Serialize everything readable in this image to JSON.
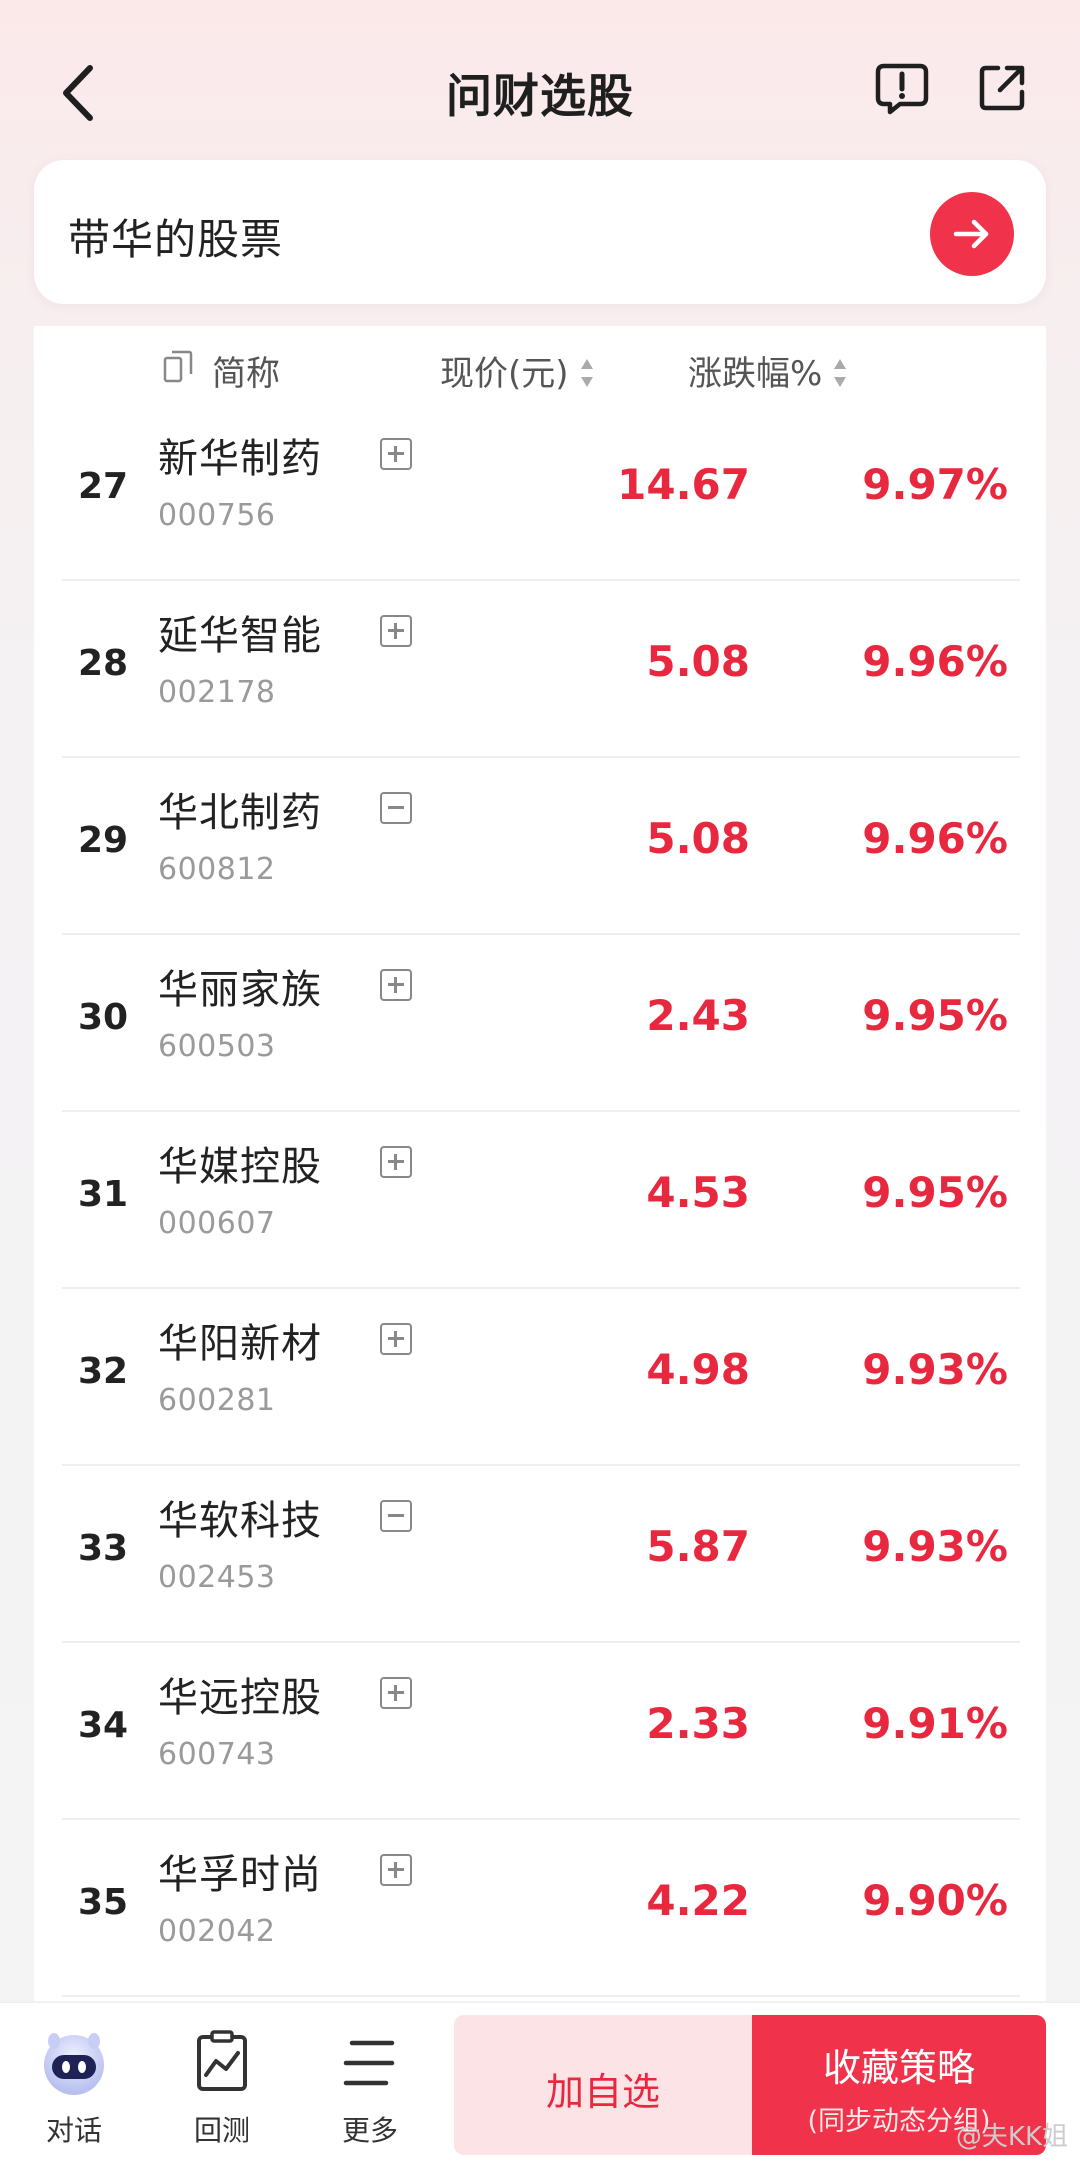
{
  "header": {
    "title": "问财选股",
    "back_icon": "chevron-left-icon",
    "feedback_icon": "feedback-icon",
    "share_icon": "share-icon"
  },
  "query": {
    "text": "带华的股票",
    "submit_icon": "arrow-right-icon"
  },
  "table": {
    "columns": {
      "name": "简称",
      "price": "现价(元)",
      "change": "涨跌幅%"
    },
    "rows": [
      {
        "index": "27",
        "name": "新华制药",
        "code": "000756",
        "price": "14.67",
        "change": "9.97%",
        "toggle": "plus"
      },
      {
        "index": "28",
        "name": "延华智能",
        "code": "002178",
        "price": "5.08",
        "change": "9.96%",
        "toggle": "plus"
      },
      {
        "index": "29",
        "name": "华北制药",
        "code": "600812",
        "price": "5.08",
        "change": "9.96%",
        "toggle": "minus"
      },
      {
        "index": "30",
        "name": "华丽家族",
        "code": "600503",
        "price": "2.43",
        "change": "9.95%",
        "toggle": "plus"
      },
      {
        "index": "31",
        "name": "华媒控股",
        "code": "000607",
        "price": "4.53",
        "change": "9.95%",
        "toggle": "plus"
      },
      {
        "index": "32",
        "name": "华阳新材",
        "code": "600281",
        "price": "4.98",
        "change": "9.93%",
        "toggle": "plus"
      },
      {
        "index": "33",
        "name": "华软科技",
        "code": "002453",
        "price": "5.87",
        "change": "9.93%",
        "toggle": "minus"
      },
      {
        "index": "34",
        "name": "华远控股",
        "code": "600743",
        "price": "2.33",
        "change": "9.91%",
        "toggle": "plus"
      },
      {
        "index": "35",
        "name": "华孚时尚",
        "code": "002042",
        "price": "4.22",
        "change": "9.90%",
        "toggle": "plus"
      }
    ]
  },
  "bottom": {
    "tabs": [
      {
        "label": "对话",
        "icon": "robot-icon"
      },
      {
        "label": "回测",
        "icon": "backtest-chart-icon"
      },
      {
        "label": "更多",
        "icon": "menu-icon"
      }
    ],
    "add_watch": "加自选",
    "save_strategy": "收藏策略",
    "save_strategy_sub": "(同步动态分组)"
  },
  "watermark": "@夫KK姐",
  "colors": {
    "accent": "#f0334b",
    "price_up": "#e8283f"
  }
}
